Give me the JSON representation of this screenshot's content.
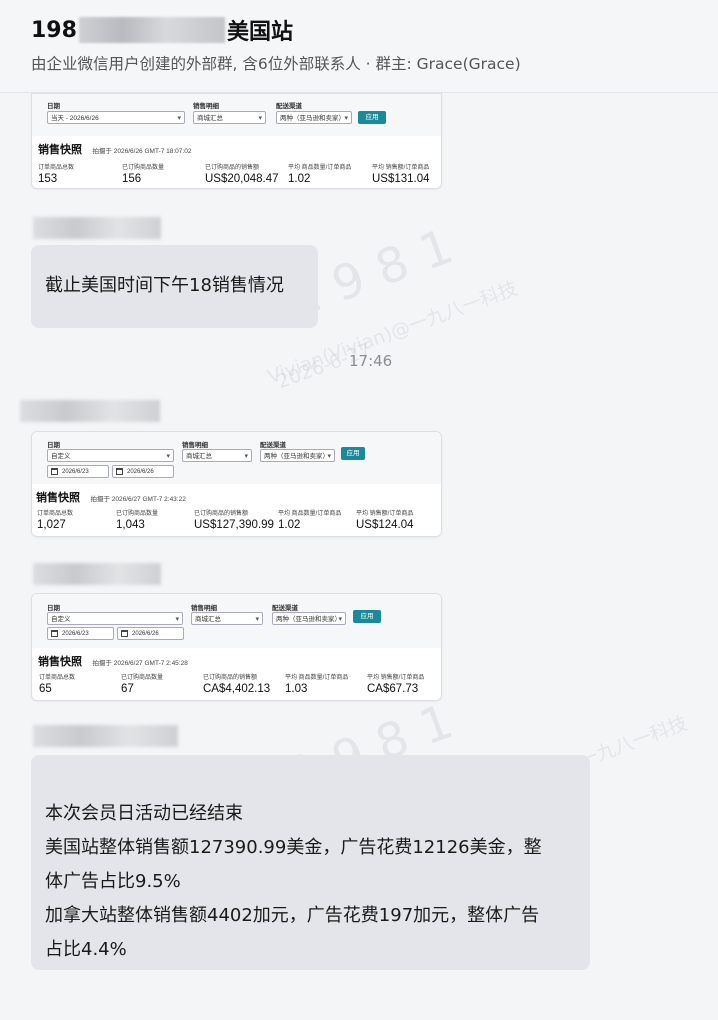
{
  "header": {
    "title_prefix": "198",
    "title_suffix": "美国站",
    "subtitle": "由企业微信用户创建的外部群, 含6位外部联系人 · 群主: Grace(Grace)"
  },
  "watermark": {
    "logo": "1981",
    "text1": "Vivian(Vivian)@一九八一科技",
    "text2": "2026-6-27"
  },
  "messages": {
    "shot1": {
      "labels": {
        "date": "日期",
        "detail": "销售明细",
        "channel": "配送渠道"
      },
      "date_select": "当天 - 2026/6/26",
      "detail_select": "商城汇总",
      "channel_select": "两种（亚马逊和卖家）",
      "apply": "应用",
      "snap_title": "销售快照",
      "snap_time": "拍摄于 2026/6/26 GMT-7 18:07:02",
      "metrics": [
        {
          "label": "订单商品总数",
          "value": "153"
        },
        {
          "label": "已订购商品数量",
          "value": "156"
        },
        {
          "label": "已订购商品的销售额",
          "value": "US$20,048.47"
        },
        {
          "label": "平均 商品数量/订单商品",
          "value": "1.02"
        },
        {
          "label": "平均 销售额/订单商品",
          "value": "US$131.04"
        }
      ]
    },
    "bubble1": "截止美国时间下午18销售情况",
    "time": "17:46",
    "shot2": {
      "labels": {
        "date": "日期",
        "detail": "销售明细",
        "channel": "配送渠道"
      },
      "date_select": "自定义",
      "date_from": "2026/6/23",
      "date_to": "2026/6/26",
      "detail_select": "商城汇总",
      "channel_select": "两种（亚马逊和卖家）",
      "apply": "应用",
      "snap_title": "销售快照",
      "snap_time": "拍摄于 2026/6/27 GMT-7 2:43:22",
      "metrics": [
        {
          "label": "订单商品总数",
          "value": "1,027"
        },
        {
          "label": "已订购商品数量",
          "value": "1,043"
        },
        {
          "label": "已订购商品的销售额",
          "value": "US$127,390.99"
        },
        {
          "label": "平均 商品数量/订单商品",
          "value": "1.02"
        },
        {
          "label": "平均 销售额/订单商品",
          "value": "US$124.04"
        }
      ]
    },
    "shot3": {
      "labels": {
        "date": "日期",
        "detail": "销售明细",
        "channel": "配送渠道"
      },
      "date_select": "自定义",
      "date_from": "2026/6/23",
      "date_to": "2026/6/26",
      "detail_select": "商城汇总",
      "channel_select": "两种（亚马逊和卖家）",
      "apply": "应用",
      "snap_title": "销售快照",
      "snap_time": "拍摄于 2026/6/27 GMT-7 2:45:28",
      "metrics": [
        {
          "label": "订单商品总数",
          "value": "65"
        },
        {
          "label": "已订购商品数量",
          "value": "67"
        },
        {
          "label": "已订购商品的销售额",
          "value": "CA$4,402.13"
        },
        {
          "label": "平均 商品数量/订单商品",
          "value": "1.03"
        },
        {
          "label": "平均 销售额/订单商品",
          "value": "CA$67.73"
        }
      ]
    },
    "bubble2": {
      "line1": "本次会员日活动已经结束",
      "line2": "美国站整体销售额127390.99美金，广告花费12126美金，整",
      "line3": "体广告占比9.5%",
      "line4": "加拿大站整体销售额4402加元，广告花费197加元，整体广告",
      "line5": "占比4.4%"
    }
  }
}
